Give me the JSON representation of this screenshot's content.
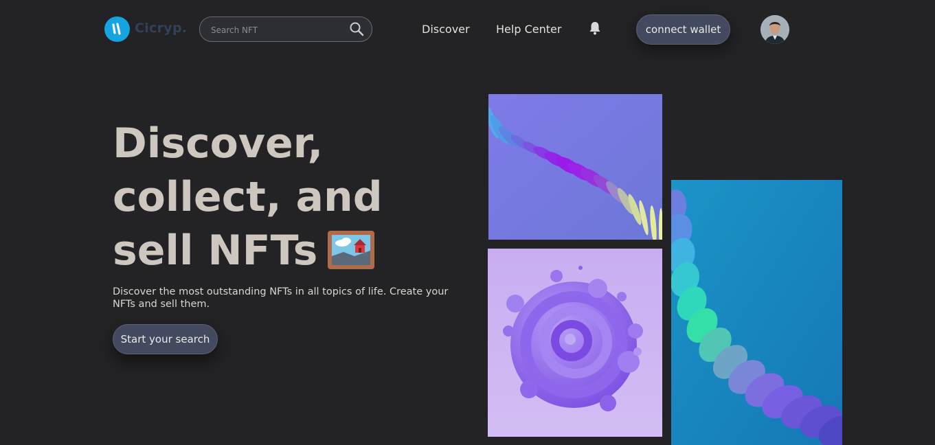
{
  "brand": {
    "name": "Cicryp."
  },
  "search": {
    "placeholder": "Search NFT"
  },
  "nav": {
    "items": [
      {
        "label": "Discover"
      },
      {
        "label": "Help Center"
      }
    ],
    "notification_icon": "bell-icon",
    "connect_wallet_label": "connect wallet"
  },
  "hero": {
    "title_lines": [
      "Discover,",
      "collect, and",
      "sell NFTs"
    ],
    "title_emoji": "framed-picture-icon",
    "subtitle": "Discover the most outstanding NFTs in all topics of life. Create your NFTs and sell them.",
    "cta_label": "Start your search"
  },
  "gallery": {
    "items": [
      {
        "name": "blue-purple-wave-artwork"
      },
      {
        "name": "purple-swirl-artwork"
      },
      {
        "name": "teal-ribbon-artwork"
      }
    ]
  },
  "colors": {
    "background": "#232325",
    "accent": "#15a4e0",
    "button": "#434a60",
    "title": "#cdc7c0"
  }
}
